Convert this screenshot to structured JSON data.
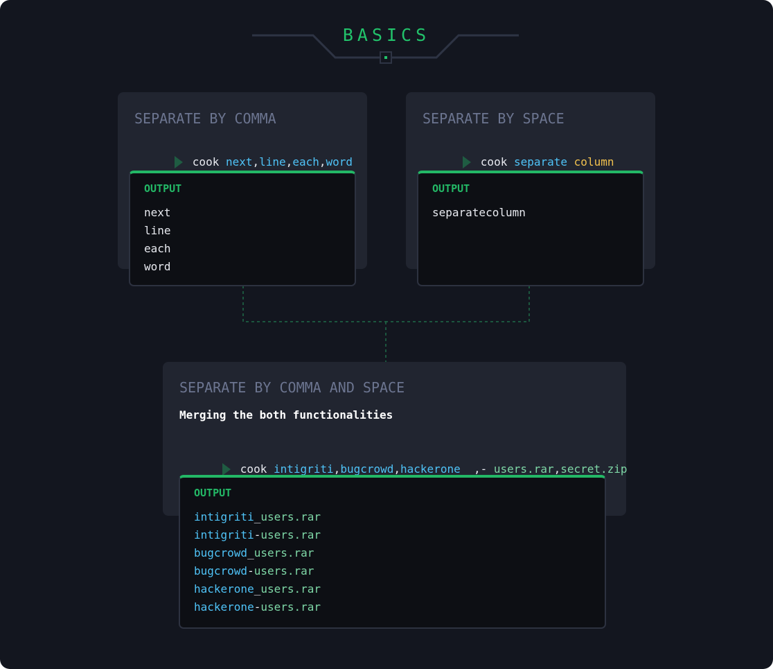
{
  "header": {
    "title": "BASICS"
  },
  "cards": {
    "comma": {
      "title": "SEPARATE BY COMMA",
      "command": {
        "prefix": "cook ",
        "parts": [
          {
            "text": "next",
            "color": "blue"
          },
          {
            "text": ",",
            "color": "white"
          },
          {
            "text": "line",
            "color": "blue"
          },
          {
            "text": ",",
            "color": "white"
          },
          {
            "text": "each",
            "color": "blue"
          },
          {
            "text": ",",
            "color": "white"
          },
          {
            "text": "word",
            "color": "blue"
          }
        ]
      },
      "output_label": "OUTPUT",
      "output": [
        "next",
        "line",
        "each",
        "word"
      ]
    },
    "space": {
      "title": "SEPARATE BY SPACE",
      "command": {
        "prefix": "cook ",
        "parts": [
          {
            "text": "separate",
            "color": "blue"
          },
          {
            "text": " ",
            "color": "white"
          },
          {
            "text": "column",
            "color": "yellow"
          }
        ]
      },
      "output_label": "OUTPUT",
      "output": [
        "separatecolumn"
      ]
    },
    "both": {
      "title": "SEPARATE BY COMMA AND SPACE",
      "description": "Merging the both functionalities",
      "command": {
        "prefix": "cook ",
        "parts": [
          {
            "text": "intigriti",
            "color": "blue"
          },
          {
            "text": ",",
            "color": "white"
          },
          {
            "text": "bugcrowd",
            "color": "blue"
          },
          {
            "text": ",",
            "color": "white"
          },
          {
            "text": "hackerone",
            "color": "blue"
          },
          {
            "text": " _,- ",
            "color": "white"
          },
          {
            "text": "users.rar",
            "color": "green"
          },
          {
            "text": ",",
            "color": "white"
          },
          {
            "text": "secret.zip",
            "color": "green"
          }
        ]
      },
      "output_label": "OUTPUT",
      "output": [
        [
          {
            "text": "intigriti",
            "color": "blue"
          },
          {
            "text": "_",
            "color": "white"
          },
          {
            "text": "users.rar",
            "color": "green"
          }
        ],
        [
          {
            "text": "intigriti",
            "color": "blue"
          },
          {
            "text": "-",
            "color": "white"
          },
          {
            "text": "users.rar",
            "color": "green"
          }
        ],
        [
          {
            "text": "bugcrowd",
            "color": "blue"
          },
          {
            "text": "_",
            "color": "white"
          },
          {
            "text": "users.rar",
            "color": "green"
          }
        ],
        [
          {
            "text": "bugcrowd",
            "color": "blue"
          },
          {
            "text": "-",
            "color": "white"
          },
          {
            "text": "users.rar",
            "color": "green"
          }
        ],
        [
          {
            "text": "hackerone",
            "color": "blue"
          },
          {
            "text": "_",
            "color": "white"
          },
          {
            "text": "users.rar",
            "color": "green"
          }
        ],
        [
          {
            "text": "hackerone",
            "color": "blue"
          },
          {
            "text": "-",
            "color": "white"
          },
          {
            "text": "users.rar",
            "color": "green"
          }
        ]
      ]
    }
  },
  "colors": {
    "background": "#13161f",
    "card": "#212530",
    "accent_green": "#23b866",
    "token_blue": "#4fc3f7",
    "token_yellow": "#f2c14e",
    "token_green": "#7ed7a6"
  }
}
